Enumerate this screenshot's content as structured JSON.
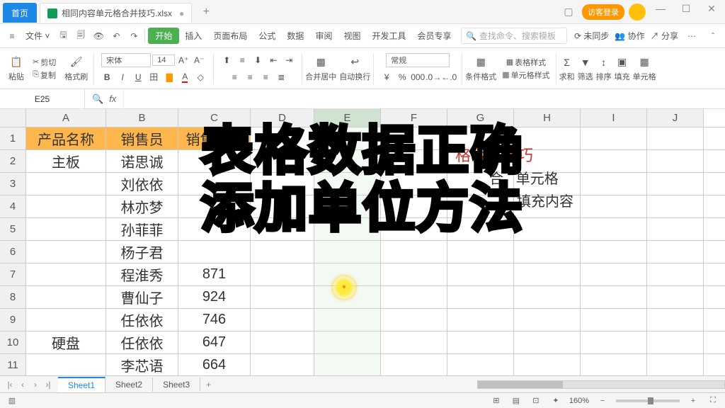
{
  "titlebar": {
    "home": "首页",
    "filename": "相同内容单元格合并技巧.xlsx",
    "login": "访客登录"
  },
  "menubar": {
    "file": "文件",
    "tabs": [
      "开始",
      "插入",
      "页面布局",
      "公式",
      "数据",
      "审阅",
      "视图",
      "开发工具",
      "会员专享"
    ],
    "search": "查找命令、搜索模板",
    "right": [
      "未同步",
      "协作",
      "分享"
    ]
  },
  "ribbon": {
    "paste": "粘贴",
    "cut": "剪切",
    "copy": "复制",
    "fmtpaint": "格式刷",
    "font": "宋体",
    "size": "14",
    "merge": "合并居中",
    "wrap": "自动换行",
    "number": "常规",
    "condfmt": "条件格式",
    "tblstyle": "表格样式",
    "cellstyle": "单元格样式",
    "sum": "求和",
    "filter": "筛选",
    "sort": "排序",
    "fill": "填充",
    "cell": "单元格"
  },
  "namebox": "E25",
  "columns": [
    "A",
    "B",
    "C",
    "D",
    "E",
    "F",
    "G",
    "H",
    "I",
    "J"
  ],
  "headers": {
    "A": "产品名称",
    "B": "销售员",
    "C": "销售数量"
  },
  "rows": [
    {
      "n": 1,
      "A": "产品名称",
      "B": "销售员",
      "C": "销售数量"
    },
    {
      "n": 2,
      "A": "主板",
      "B": "诺思诚",
      "C": ""
    },
    {
      "n": 3,
      "A": "",
      "B": "刘依依",
      "C": ""
    },
    {
      "n": 4,
      "A": "",
      "B": "林亦梦",
      "C": ""
    },
    {
      "n": 5,
      "A": "",
      "B": "孙菲菲",
      "C": ""
    },
    {
      "n": 6,
      "A": "",
      "B": "杨子君",
      "C": ""
    },
    {
      "n": 7,
      "A": "",
      "B": "程淮秀",
      "C": "871"
    },
    {
      "n": 8,
      "A": "",
      "B": "曹仙子",
      "C": "924"
    },
    {
      "n": 9,
      "A": "",
      "B": "任依依",
      "C": "746"
    },
    {
      "n": 10,
      "A": "硬盘",
      "B": "任依依",
      "C": "647"
    },
    {
      "n": 11,
      "A": "",
      "B": "李芯语",
      "C": "664"
    }
  ],
  "sidetext": {
    "l1": "格合并技巧",
    "l2a": "合",
    "l2b": "单元格",
    "l3": "填充内容"
  },
  "sheets": [
    "Sheet1",
    "Sheet2",
    "Sheet3"
  ],
  "statusbar": {
    "zoom": "160%"
  },
  "overlay": {
    "l1": "表格数据正确",
    "l2": "添加单位方法"
  }
}
